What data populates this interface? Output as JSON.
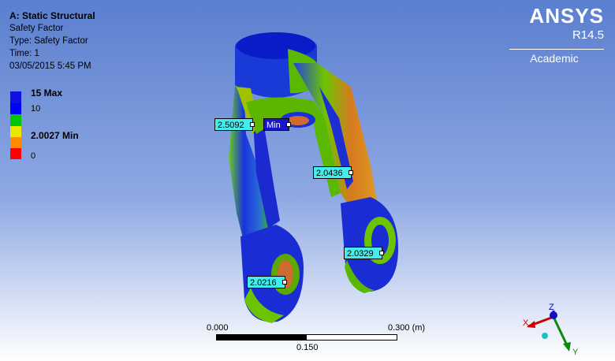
{
  "info": {
    "title": "A: Static Structural",
    "line1": "Safety Factor",
    "line2": "Type: Safety Factor",
    "line3": "Time: 1",
    "line4": "03/05/2015 5:45 PM"
  },
  "legend": {
    "max_label": "15 Max",
    "mid_label": "10",
    "min_label": "2.0027 Min",
    "zero_label": "0",
    "colors": [
      "#0000ff",
      "#0000ff",
      "#00c800",
      "#ffff00",
      "#ff8c00",
      "#ff0000"
    ]
  },
  "logo": {
    "brand": "ANSYS",
    "version": "R14.5",
    "edition": "Academic"
  },
  "probes": {
    "p1": "2.5092",
    "min": "Min",
    "p2": "2.0436",
    "p3": "2.0329",
    "p4": "2.0216"
  },
  "scale": {
    "start": "0.000",
    "end": "0.300 (m)",
    "mid": "0.150"
  },
  "triad": {
    "x": "X",
    "y": "Y",
    "z": "Z"
  }
}
